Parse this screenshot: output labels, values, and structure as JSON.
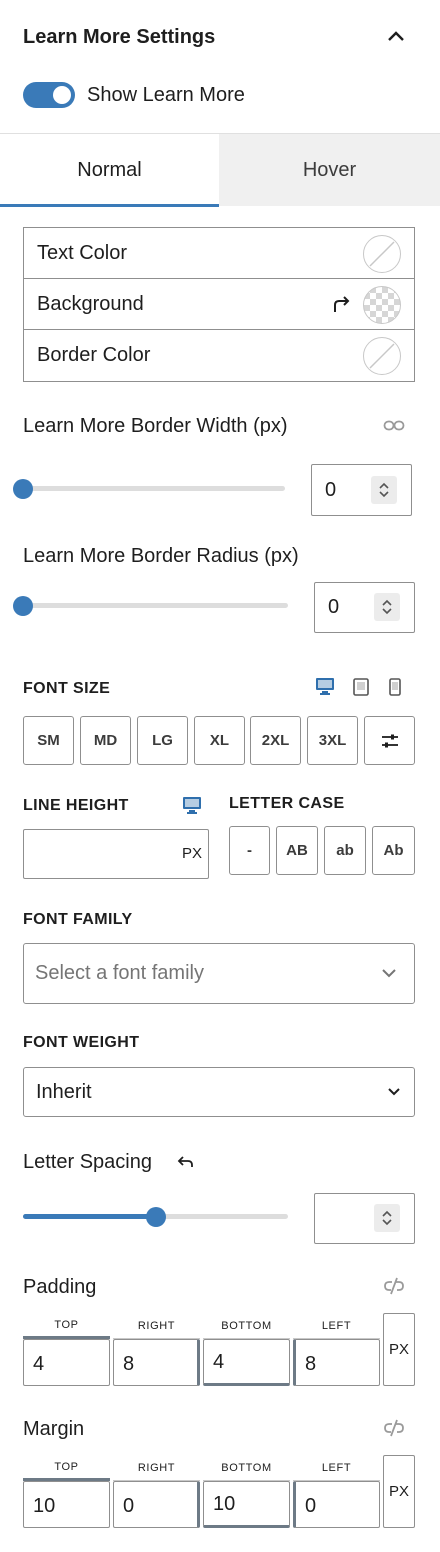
{
  "panel": {
    "title": "Learn More Settings",
    "collapse_icon": "chevron-up-icon"
  },
  "toggle": {
    "label": "Show Learn More",
    "on": true
  },
  "tabs": [
    {
      "label": "Normal",
      "active": true
    },
    {
      "label": "Hover",
      "active": false
    }
  ],
  "colors": [
    {
      "label": "Text Color",
      "swatch": "empty"
    },
    {
      "label": "Background",
      "swatch": "transparent",
      "reset_icon": "reset-arrow-icon"
    },
    {
      "label": "Border Color",
      "swatch": "empty"
    }
  ],
  "border_width": {
    "label": "Learn More Border Width (px)",
    "value": "0",
    "slider": 0,
    "link_icon": "link-icon"
  },
  "border_radius": {
    "label": "Learn More Border Radius (px)",
    "value": "0",
    "slider": 0
  },
  "font_size": {
    "label": "FONT SIZE",
    "devices": [
      "desktop-icon",
      "tablet-icon",
      "mobile-icon"
    ],
    "presets": [
      "SM",
      "MD",
      "LG",
      "XL",
      "2XL",
      "3XL"
    ],
    "custom_icon": "sliders-icon"
  },
  "line_height": {
    "label": "LINE HEIGHT",
    "value": "",
    "unit": "PX",
    "device_icon": "desktop-icon"
  },
  "letter_case": {
    "label": "LETTER CASE",
    "options": [
      "-",
      "AB",
      "ab",
      "Ab"
    ]
  },
  "font_family": {
    "label": "FONT FAMILY",
    "placeholder": "Select a font family"
  },
  "font_weight": {
    "label": "FONT WEIGHT",
    "value": "Inherit"
  },
  "letter_spacing": {
    "label": "Letter Spacing",
    "value": "",
    "slider": 0.5,
    "reset_icon": "undo-icon"
  },
  "padding": {
    "label": "Padding",
    "unit": "PX",
    "link_icon": "unlink-icon",
    "sides": [
      {
        "label": "TOP",
        "value": "4"
      },
      {
        "label": "RIGHT",
        "value": "8"
      },
      {
        "label": "BOTTOM",
        "value": "4"
      },
      {
        "label": "LEFT",
        "value": "8"
      }
    ]
  },
  "margin": {
    "label": "Margin",
    "unit": "PX",
    "link_icon": "unlink-icon",
    "sides": [
      {
        "label": "TOP",
        "value": "10"
      },
      {
        "label": "RIGHT",
        "value": "0"
      },
      {
        "label": "BOTTOM",
        "value": "10"
      },
      {
        "label": "LEFT",
        "value": "0"
      }
    ]
  },
  "accent_color": "#3a7ab8"
}
